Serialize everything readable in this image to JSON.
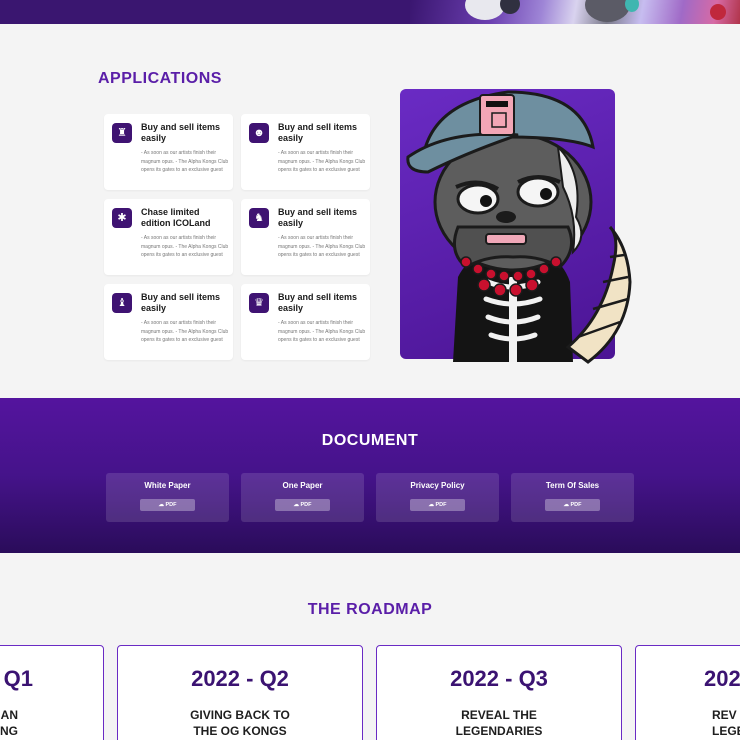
{
  "applications": {
    "title": "APPLICATIONS",
    "cards": [
      {
        "icon": "logo-icon",
        "title": "Buy and sell items easily",
        "desc": "- As soon as our artists finish their magnum opus. - The Alpha Kongs Club opens its gates to an exclusive guest"
      },
      {
        "icon": "mask-icon",
        "title": "Buy and sell items easily",
        "desc": "- As soon as our artists finish their magnum opus. - The Alpha Kongs Club opens its gates to an exclusive guest"
      },
      {
        "icon": "spider-icon",
        "title": "Chase limited edition ICOLand",
        "desc": "- As soon as our artists finish their magnum opus. - The Alpha Kongs Club opens its gates to an exclusive guest"
      },
      {
        "icon": "cat-icon",
        "title": "Buy and sell items easily",
        "desc": "- As soon as our artists finish their magnum opus. - The Alpha Kongs Club opens its gates to an exclusive guest"
      },
      {
        "icon": "bat-icon",
        "title": "Buy and sell items easily",
        "desc": "- As soon as our artists finish their magnum opus. - The Alpha Kongs Club opens its gates to an exclusive guest"
      },
      {
        "icon": "bear-icon",
        "title": "Buy and sell items easily",
        "desc": "- As soon as our artists finish their magnum opus. - The Alpha Kongs Club opens its gates to an exclusive guest"
      }
    ]
  },
  "document": {
    "title": "DOCUMENT",
    "items": [
      {
        "title": "White Paper",
        "button": "PDF"
      },
      {
        "title": "One Paper",
        "button": "PDF"
      },
      {
        "title": "Privacy Policy",
        "button": "PDF"
      },
      {
        "title": "Term Of Sales",
        "button": "PDF"
      }
    ]
  },
  "roadmap": {
    "title": "THE ROADMAP",
    "cards": [
      {
        "year": "Q1",
        "text": "AN\nNG"
      },
      {
        "year": "2022 - Q2",
        "text": "GIVING BACK TO\nTHE OG KONGS"
      },
      {
        "year": "2022 - Q3",
        "text": "REVEAL THE\nLEGENDARIES"
      },
      {
        "year": "202",
        "text": "REV\nLEGE"
      }
    ]
  },
  "colors": {
    "accent": "#5a1ea8",
    "dark_purple": "#3f1372",
    "band": "#45138a"
  }
}
